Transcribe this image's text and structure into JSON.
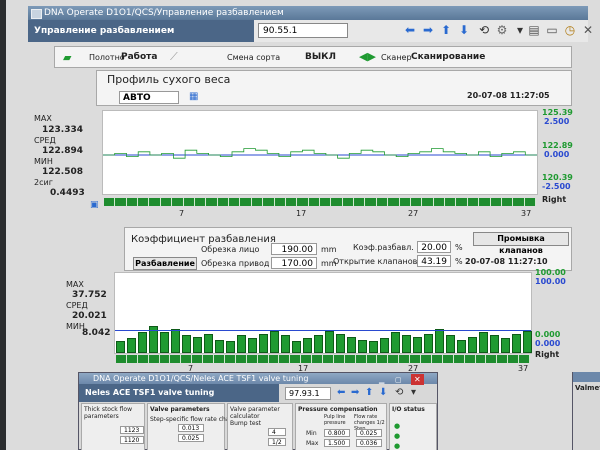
{
  "window": {
    "title": "DNA Operate D1O1/QCS/Управление разбавлением"
  },
  "toolbar": {
    "app_title": "Управление разбавлением",
    "path_value": "90.55.1"
  },
  "status": {
    "mode_label": "Полотно",
    "mode_value": "Работа",
    "grade_label": "Смена сорта",
    "grade_value": "ВЫКЛ",
    "scanner_label": "Сканер",
    "scanner_value": "Сканирование"
  },
  "profile": {
    "title": "Профиль сухого веса",
    "mode": "АВТО",
    "timestamp": "20-07-08 11:27:05",
    "stats": [
      {
        "label": "MAX",
        "value": "123.334"
      },
      {
        "label": "СРЕД",
        "value": "122.894"
      },
      {
        "label": "МИН",
        "value": "122.508"
      },
      {
        "label": "2сиг",
        "value": "0.4493"
      }
    ],
    "right_axis": {
      "top": "125.39",
      "top2": "2.500",
      "mid": "122.89",
      "mid2": "0.000",
      "bot": "120.39",
      "bot2": "-2.500"
    },
    "side_label": "Right",
    "ticks": [
      "7",
      "17",
      "27",
      "37"
    ]
  },
  "dilution": {
    "title": "Коэффициент разбавления",
    "mode_label": "Разбавление",
    "trim_face_label": "Обрезка лицо",
    "trim_face_value": "190.00",
    "trim_face_unit": "mm",
    "trim_drive_label": "Обрезка привод",
    "trim_drive_value": "170.00",
    "trim_drive_unit": "mm",
    "ratio_label": "Коэф.разбавл.",
    "ratio_value": "20.00",
    "ratio_unit": "%",
    "valve_label": "Открытие клапанов",
    "valve_value": "43.19",
    "valve_unit": "%",
    "flush_button": "Промывка клапанов",
    "timestamp": "20-07-08 11:27:10",
    "stats": [
      {
        "label": "MAX",
        "value": "37.752"
      },
      {
        "label": "СРЕД",
        "value": "20.021"
      },
      {
        "label": "МИН",
        "value": "8.042"
      }
    ],
    "right_axis": {
      "top": "100.00",
      "top2": "100.00",
      "bot": "0.000",
      "bot2": "0.000"
    },
    "side_label": "Right",
    "ticks": [
      "7",
      "17",
      "27",
      "37"
    ]
  },
  "subwindow": {
    "title": "DNA Operate D1O1/QCS/Neles ACE TSF1 valve tuning",
    "app_title": "Neles ACE TSF1 valve tuning",
    "path_value": "97.93.1",
    "col1_title": "Thick stock flow parameters",
    "col2_title": "Valve parameters",
    "col3_title": "Valve parameter calculator",
    "col4_title": "Pressure compensation",
    "col5_title": "I/O status",
    "c1_val1": "1123",
    "c1_val2": "1120",
    "c2_row1": "Step-specific flow rate changes",
    "c2_val1": "0.013",
    "c2_val2": "0.025",
    "c3_row1": "Bump test",
    "c3_val1": "4",
    "c3_val2": "1/2",
    "c4_h1": "Pulp line pressure",
    "c4_h2": "Flow rate changes 1/2 Step",
    "c4_min": "Min",
    "c4_max": "Max",
    "c4_v1": "0.800",
    "c4_v2": "0.025",
    "c4_v3": "1.500",
    "c4_v4": "0.036"
  },
  "right_window": {
    "title": "Valmet"
  }
}
